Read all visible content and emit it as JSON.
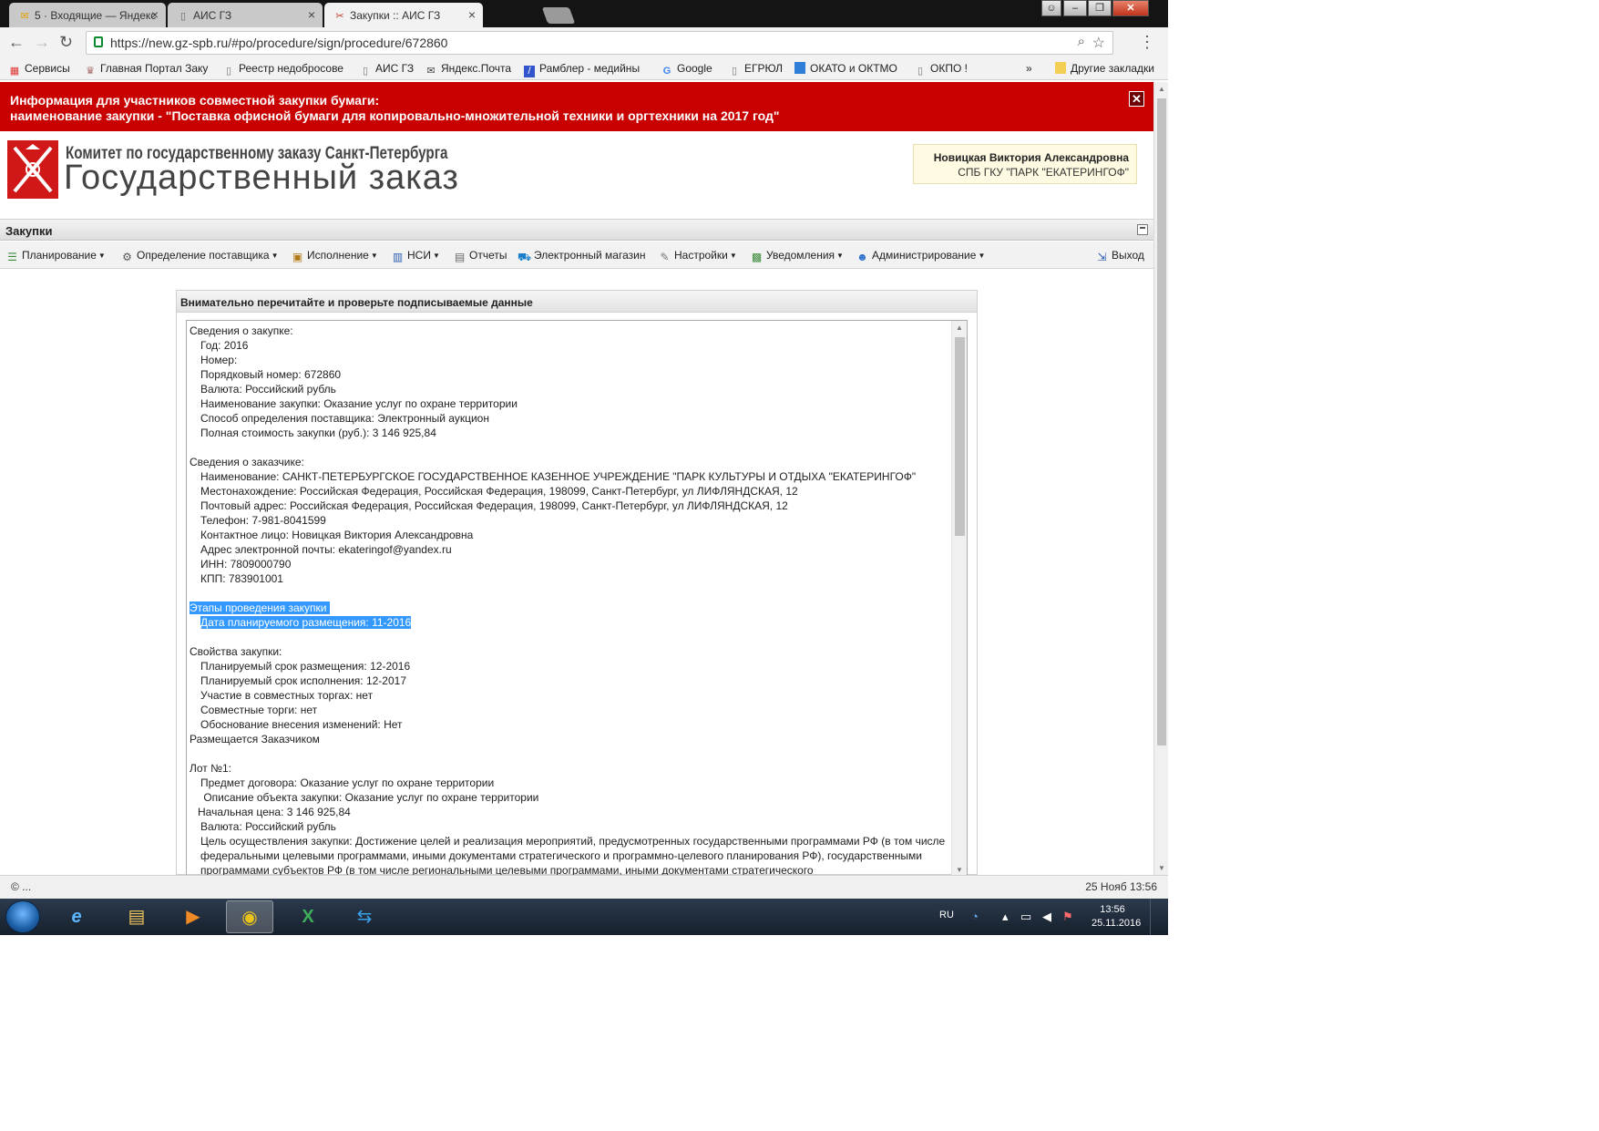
{
  "browser": {
    "tabs": [
      {
        "title": "5 · Входящие — Яндекс",
        "icon": "mail-envelope-icon"
      },
      {
        "title": "АИС ГЗ",
        "icon": "page-icon"
      },
      {
        "title": "Закупки :: АИС ГЗ",
        "icon": "tools-icon",
        "active": true
      }
    ],
    "url": "https://new.gz-spb.ru/#po/procedure/sign/procedure/672860",
    "bookmarks": [
      {
        "label": "Сервисы",
        "icon": "apps-grid-icon"
      },
      {
        "label": "Главная Портал Заку",
        "icon": "emblem-icon"
      },
      {
        "label": "Реестр недобросове",
        "icon": "page-icon"
      },
      {
        "label": "АИС ГЗ",
        "icon": "page-icon"
      },
      {
        "label": "Яндекс.Почта",
        "icon": "mail-icon"
      },
      {
        "label": "Рамблер - медийны",
        "icon": "rambler-icon"
      },
      {
        "label": "Google",
        "icon": "google-icon"
      },
      {
        "label": "ЕГРЮЛ",
        "icon": "page-icon"
      },
      {
        "label": "ОКАТО и ОКТМО",
        "icon": "blue-square-icon"
      },
      {
        "label": "ОКПО !",
        "icon": "page-icon"
      }
    ],
    "bookmarks_more": "»",
    "other_bookmarks": "Другие закладки"
  },
  "notice": {
    "line1": "Информация для участников совместной закупки бумаги:",
    "line2": "наименование закупки - \"Поставка офисной бумаги для копировально-множительной техники и оргтехники на 2017 год\"",
    "close": "✕"
  },
  "header": {
    "org_line1": "Комитет по государственному заказу Санкт-Петербурга",
    "org_line2": "Государственный заказ",
    "user_name": "Новицкая Виктория Александровна",
    "user_org": "СПБ ГКУ \"ПАРК \"ЕКАТЕРИНГОФ\""
  },
  "section": {
    "title": "Закупки"
  },
  "menu": {
    "items": [
      {
        "label": "Планирование",
        "icon": "planning-icon",
        "dropdown": true
      },
      {
        "label": "Определение поставщика",
        "icon": "gears-icon",
        "dropdown": true
      },
      {
        "label": "Исполнение",
        "icon": "execution-icon",
        "dropdown": true
      },
      {
        "label": "НСИ",
        "icon": "book-icon",
        "dropdown": true
      },
      {
        "label": "Отчеты",
        "icon": "report-icon",
        "dropdown": false
      },
      {
        "label": "Электронный магазин",
        "icon": "cart-icon",
        "dropdown": false
      },
      {
        "label": "Настройки",
        "icon": "wrench-icon",
        "dropdown": true
      },
      {
        "label": "Уведомления",
        "icon": "notification-icon",
        "dropdown": true
      },
      {
        "label": "Администрирование",
        "icon": "admin-user-icon",
        "dropdown": true
      }
    ],
    "logout": "Выход"
  },
  "panel": {
    "title": "Внимательно перечитайте и проверьте подписываемые данные",
    "lines": [
      {
        "t": "Сведения о закупке:",
        "i": 0
      },
      {
        "t": "Год: 2016",
        "i": 1
      },
      {
        "t": "Номер:",
        "i": 1
      },
      {
        "t": "Порядковый номер: 672860",
        "i": 1
      },
      {
        "t": "Валюта: Российский рубль",
        "i": 1
      },
      {
        "t": "Наименование закупки: Оказание услуг по охране территории",
        "i": 1
      },
      {
        "t": "Способ определения поставщика: Электронный аукцион",
        "i": 1
      },
      {
        "t": "Полная стоимость закупки (руб.): 3 146 925,84",
        "i": 1
      },
      {
        "t": "",
        "i": 0
      },
      {
        "t": "Сведения о заказчике:",
        "i": 0
      },
      {
        "t": "Наименование: САНКТ-ПЕТЕРБУРГСКОЕ ГОСУДАРСТВЕННОЕ КАЗЕННОЕ УЧРЕЖДЕНИЕ \"ПАРК КУЛЬТУРЫ И ОТДЫХА \"ЕКАТЕРИНГОФ\"",
        "i": 1
      },
      {
        "t": "Местонахождение: Российская Федерация, Российская Федерация, 198099, Санкт-Петербург, ул ЛИФЛЯНДСКАЯ, 12",
        "i": 1
      },
      {
        "t": "Почтовый адрес: Российская Федерация, Российская Федерация, 198099, Санкт-Петербург, ул ЛИФЛЯНДСКАЯ, 12",
        "i": 1
      },
      {
        "t": "Телефон: 7-981-8041599",
        "i": 1
      },
      {
        "t": "Контактное лицо: Новицкая Виктория Александровна",
        "i": 1
      },
      {
        "t": "Адрес электронной почты: ekateringof@yandex.ru",
        "i": 1
      },
      {
        "t": "ИНН: 7809000790",
        "i": 1
      },
      {
        "t": "КПП: 783901001",
        "i": 1
      },
      {
        "t": "",
        "i": 0
      },
      {
        "t": "Этапы проведения закупки ",
        "i": 0,
        "hl": true
      },
      {
        "t": "Дата планируемого размещения: 11-2016",
        "i": 1,
        "hl": true
      },
      {
        "t": "",
        "i": 0
      },
      {
        "t": "Свойства закупки:",
        "i": 0
      },
      {
        "t": "Планируемый срок размещения: 12-2016",
        "i": 1
      },
      {
        "t": "Планируемый срок исполнения: 12-2017",
        "i": 1
      },
      {
        "t": "Участие в совместных торгах: нет",
        "i": 1
      },
      {
        "t": "Совместные торги: нет",
        "i": 1
      },
      {
        "t": "Обоснование внесения изменений: Нет",
        "i": 1
      },
      {
        "t": "Размещается Заказчиком",
        "i": 0
      },
      {
        "t": "",
        "i": 0
      },
      {
        "t": "Лот №1:",
        "i": 0
      },
      {
        "t": "Предмет договора: Оказание услуг по охране территории",
        "i": 1
      },
      {
        "t": " Описание объекта закупки: Оказание услуг по охране территории",
        "i": 1
      },
      {
        "t": "Начальная цена: 3 146 925,84",
        "i": 2
      },
      {
        "t": "Валюта: Российский рубль",
        "i": 1
      },
      {
        "t": "Цель осуществления закупки: Достижение целей и реализация мероприятий, предусмотренных государственными программами РФ (в том числе федеральными целевыми программами, иными документами стратегического и программно-целевого планирования РФ), государственными программами субъектов РФ (в том числе региональными целевыми программами, иными документами стратегического",
        "i": 1,
        "wrap": true
      }
    ]
  },
  "status": {
    "left": "© ...",
    "right": "25 Нояб 13:56"
  },
  "taskbar": {
    "apps": [
      {
        "name": "internet-explorer",
        "glyph": "e"
      },
      {
        "name": "file-explorer",
        "glyph": "▤"
      },
      {
        "name": "media-player",
        "glyph": "▶"
      },
      {
        "name": "chrome",
        "glyph": "◉",
        "active": true
      },
      {
        "name": "excel",
        "glyph": "X"
      },
      {
        "name": "teamviewer",
        "glyph": "⇆"
      }
    ],
    "lang": "RU",
    "time": "13:56",
    "date": "25.11.2016"
  }
}
